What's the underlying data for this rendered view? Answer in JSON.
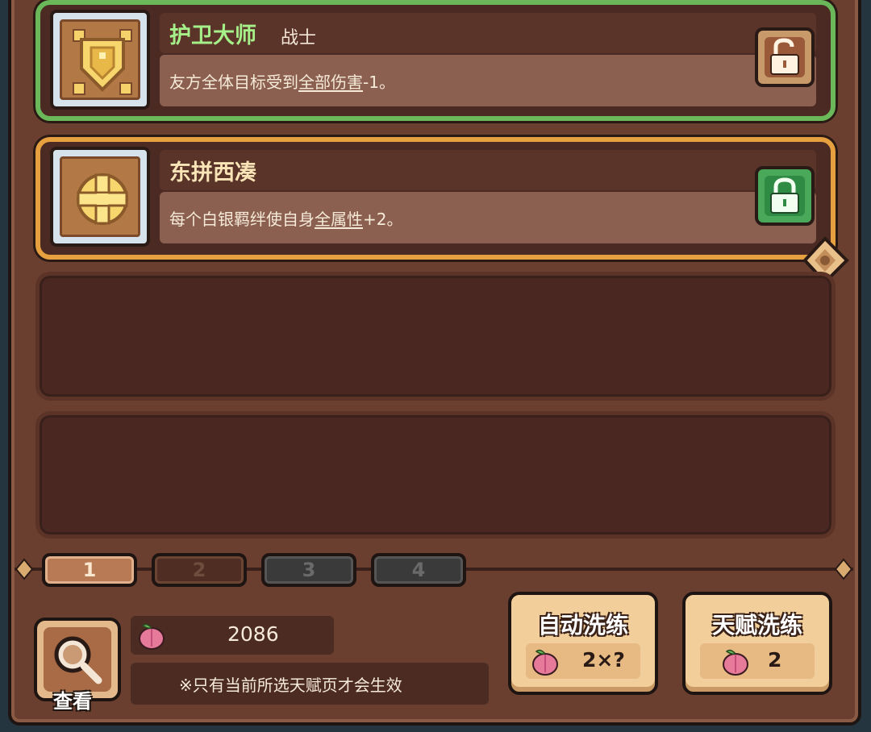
{
  "talents": [
    {
      "name": "护卫大师",
      "class": "战士",
      "desc_pre": "友方全体目标受到",
      "desc_link": "全部伤害",
      "desc_post": "-1。",
      "icon": "shield-icon",
      "lock": "unlocked"
    },
    {
      "name": "东拼西凑",
      "desc_pre": "每个白银羁绊使自身",
      "desc_link": "全属性",
      "desc_post": "+2。",
      "icon": "plus-icon",
      "lock": "locked"
    }
  ],
  "tabs": [
    "1",
    "2",
    "3",
    "4"
  ],
  "active_tab": "1",
  "view_label": "查看",
  "currency": "2086",
  "notice": "※只有当前所选天赋页才会生效",
  "buttons": {
    "auto_refine": {
      "label": "自动洗练",
      "cost": "2×?"
    },
    "talent_refine": {
      "label": "天赋洗练",
      "cost": "2"
    }
  },
  "colors": {
    "green_border": "#6ab85a",
    "orange_border": "#e7a040",
    "title_green": "#a6f08a",
    "panel": "#6b3f2f"
  }
}
